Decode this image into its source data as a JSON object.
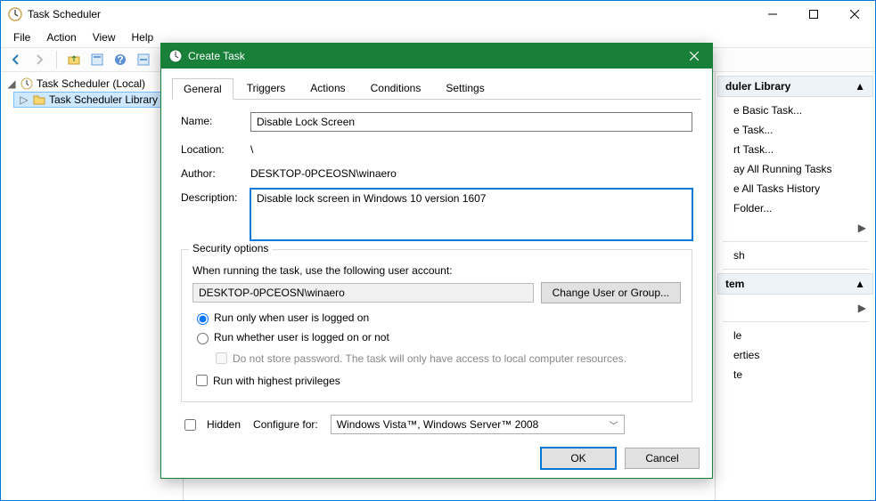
{
  "window": {
    "title": "Task Scheduler",
    "menus": [
      "File",
      "Action",
      "View",
      "Help"
    ]
  },
  "tree": {
    "root": "Task Scheduler (Local)",
    "library": "Task Scheduler Library"
  },
  "actions": {
    "header": "duler Library",
    "items": [
      "e Basic Task...",
      "e Task...",
      "rt Task...",
      "ay All Running Tasks",
      "e All Tasks History",
      "Folder..."
    ],
    "items2": [
      "sh"
    ],
    "items3": [
      "tem"
    ],
    "items4": [
      "le",
      "erties",
      "te"
    ]
  },
  "dialog": {
    "title": "Create Task",
    "tabs": [
      "General",
      "Triggers",
      "Actions",
      "Conditions",
      "Settings"
    ],
    "labels": {
      "name": "Name:",
      "location": "Location:",
      "author": "Author:",
      "description": "Description:"
    },
    "values": {
      "name": "Disable Lock Screen",
      "location": "\\",
      "author": "DESKTOP-0PCEOSN\\winaero",
      "description": "Disable lock screen in Windows 10 version 1607"
    },
    "security": {
      "legend": "Security options",
      "prompt": "When running the task, use the following user account:",
      "account": "DESKTOP-0PCEOSN\\winaero",
      "change_btn": "Change User or Group...",
      "radio_logged_on": "Run only when user is logged on",
      "radio_whether": "Run whether user is logged on or not",
      "no_store": "Do not store password.  The task will only have access to local computer resources.",
      "highest": "Run with highest privileges"
    },
    "hidden_label": "Hidden",
    "configure_label": "Configure for:",
    "configure_value": "Windows Vista™, Windows Server™ 2008",
    "ok": "OK",
    "cancel": "Cancel"
  }
}
